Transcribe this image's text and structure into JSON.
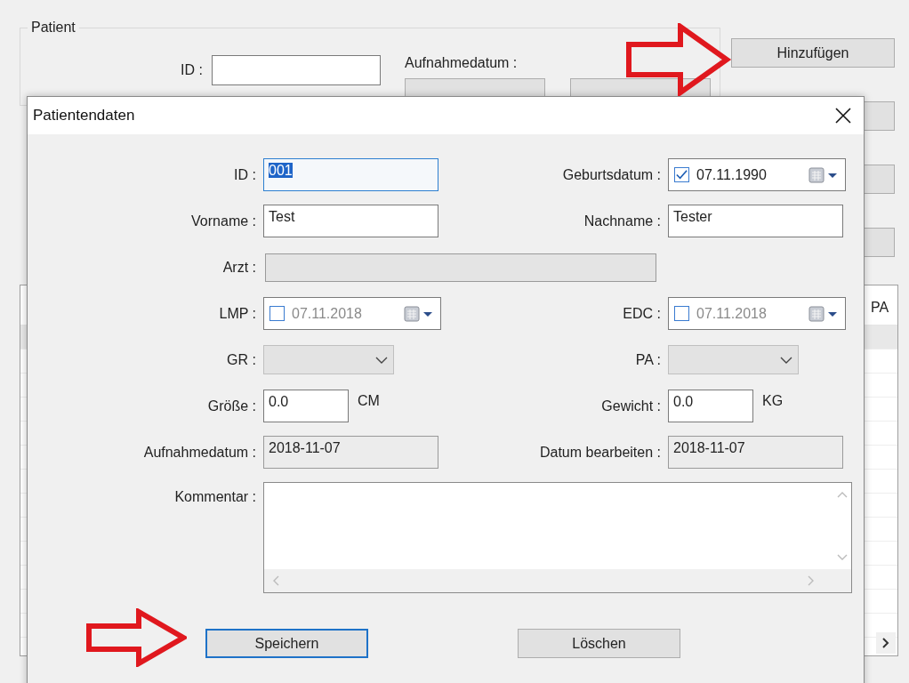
{
  "background": {
    "group_title": "Patient",
    "id_label": "ID :",
    "date_label": "Aufnahmedatum :",
    "side_button": "Hinzufügen",
    "table_column": "PA"
  },
  "dialog": {
    "title": "Patientendaten",
    "rows": [
      {
        "left": {
          "label": "ID :",
          "kind": "text",
          "value": "001",
          "focused": true
        },
        "right": {
          "label": "Geburtsdatum :",
          "kind": "date",
          "value": "07.11.1990",
          "checked": true
        }
      },
      {
        "left": {
          "label": "Vorname :",
          "kind": "text",
          "value": "Test",
          "focused": false
        },
        "right": {
          "label": "Nachname :",
          "kind": "text",
          "value": "Tester",
          "focused": false
        }
      },
      {
        "left": {
          "label": "Arzt :",
          "kind": "wide-readonly"
        }
      },
      {
        "left": {
          "label": "LMP :",
          "kind": "date",
          "value": "07.11.2018",
          "checked": false
        },
        "right": {
          "label": "EDC :",
          "kind": "date",
          "value": "07.11.2018",
          "checked": false
        }
      },
      {
        "left": {
          "label": "GR :",
          "kind": "combo"
        },
        "right": {
          "label": "PA :",
          "kind": "combo"
        }
      },
      {
        "left": {
          "label": "Größe :",
          "kind": "unit",
          "value": "0.0",
          "unit": "CM"
        },
        "right": {
          "label": "Gewicht :",
          "kind": "unit",
          "value": "0.0",
          "unit": "KG"
        }
      },
      {
        "left": {
          "label": "Aufnahmedatum :",
          "kind": "readonly",
          "value": "2018-11-07"
        },
        "right": {
          "label": "Datum bearbeiten :",
          "kind": "readonly",
          "value": "2018-11-07"
        }
      }
    ],
    "comment_label": "Kommentar :",
    "buttons": [
      {
        "label": "Speichern",
        "focused": true
      },
      {
        "label": "Löschen",
        "focused": false
      }
    ]
  }
}
